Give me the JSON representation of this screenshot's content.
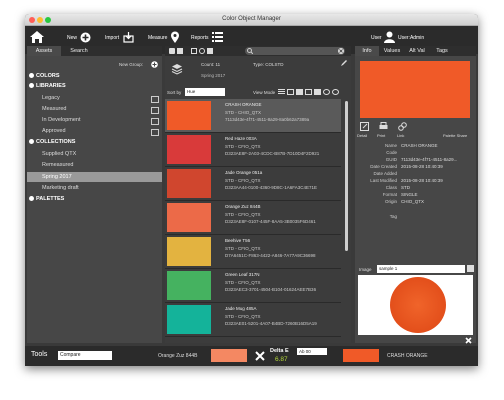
{
  "window": {
    "title": "Color Object Manager"
  },
  "toolbar": {
    "new_label": "New",
    "import_label": "Import",
    "measure_label": "Measure",
    "reports_label": "Reports",
    "user_label": "User",
    "user_name": "User:Admin"
  },
  "left_panel": {
    "tabs": [
      "Assets",
      "Search"
    ],
    "new_group_label": "New Group:",
    "tree": {
      "colors": "COLORS",
      "libraries": "LIBRARIES",
      "library_items": [
        "Legacy",
        "Measured",
        "In Development",
        "Approved"
      ],
      "collections": "COLLECTIONS",
      "collection_items": [
        "Supplied QTX",
        "Remeasured",
        "Spring 2017",
        "Marketing draft"
      ],
      "palettes": "PALETTES"
    }
  },
  "middle_panel": {
    "count_label": "Count: 11",
    "type_label": "Type: COLSTD",
    "collection_name": "Spring 2017",
    "sort_by_label": "Sort by",
    "sort_by_value": "Hue",
    "view_mode_label": "View Mode",
    "swatches": [
      {
        "name": "CRASH ORANGE",
        "line1": "STD - CHIO_QTX",
        "line2": "7113d43e-4f71-4511-8a29-8a0b62a7389a",
        "color": "#f05a28"
      },
      {
        "name": "Red Haze 003A",
        "line1": "STD - CFIO_QTX",
        "line2": "D323AE8F-2A03-4CDC-B87B-7D10D4F2D921",
        "color": "#d93a3a"
      },
      {
        "name": "Jade Orange 051a",
        "line1": "STD - CFIO_QTX",
        "line2": "D323AA44-0100-4360-9D8C-1A6FA3C4E71E",
        "color": "#d0462e"
      },
      {
        "name": "Orange Zuz 844B",
        "line1": "STD - CFIO_QTX",
        "line2": "D323AE8F-0107-445F-8AA5-3B0035F6D461",
        "color": "#ec6a48"
      },
      {
        "name": "Beehive T56",
        "line1": "STD - CFIO_QTX",
        "line2": "D7A6451C-F863-4422-A846-7A77A9C36698",
        "color": "#e3b340"
      },
      {
        "name": "Green Leaf 317N",
        "line1": "STD - CFIO_QTX",
        "line2": "D323AEC3-3701-4504-B104-01624AEE7B36",
        "color": "#45b260"
      },
      {
        "name": "Jade Mug 485A",
        "line1": "STD - CFIO_QTX",
        "line2": "D323AE01-5201-4A07-B4BD-7260B16D5A19",
        "color": "#14b39a"
      }
    ]
  },
  "right_panel": {
    "tabs": [
      "Info",
      "Values",
      "Alt Val",
      "Tags"
    ],
    "preview_color": "#f05a28",
    "actions": [
      "Detail",
      "Print",
      "Link",
      "Palette Share"
    ],
    "details": [
      {
        "label": "Name",
        "value": "CRASH ORANGE"
      },
      {
        "label": "Code",
        "value": ""
      },
      {
        "label": "GUID",
        "value": "7113d43e-4f71-4511-8a29..."
      },
      {
        "label": "Date Created",
        "value": "2015-08-28 10:40:39"
      },
      {
        "label": "Date Added",
        "value": ""
      },
      {
        "label": "Last Modified",
        "value": "2015-08-28 10:40:39"
      },
      {
        "label": "Class",
        "value": "STD"
      },
      {
        "label": "Format",
        "value": "SINGLE"
      },
      {
        "label": "Origin",
        "value": "CHIO_QTX"
      },
      {
        "label": "Tag",
        "value": ""
      }
    ],
    "image_label": "Image",
    "image_select": "sample 1",
    "image_color": "#e8541e"
  },
  "bottom_bar": {
    "tools_label": "Tools",
    "tools_select": "Compare",
    "left_name": "Orange Zuz 844B",
    "left_color": "#f48862",
    "delta_label": "Delta E",
    "delta_mode": "Ab 00",
    "delta_value": "6.87",
    "right_color": "#f05a28",
    "right_name": "CRASH ORANGE"
  }
}
